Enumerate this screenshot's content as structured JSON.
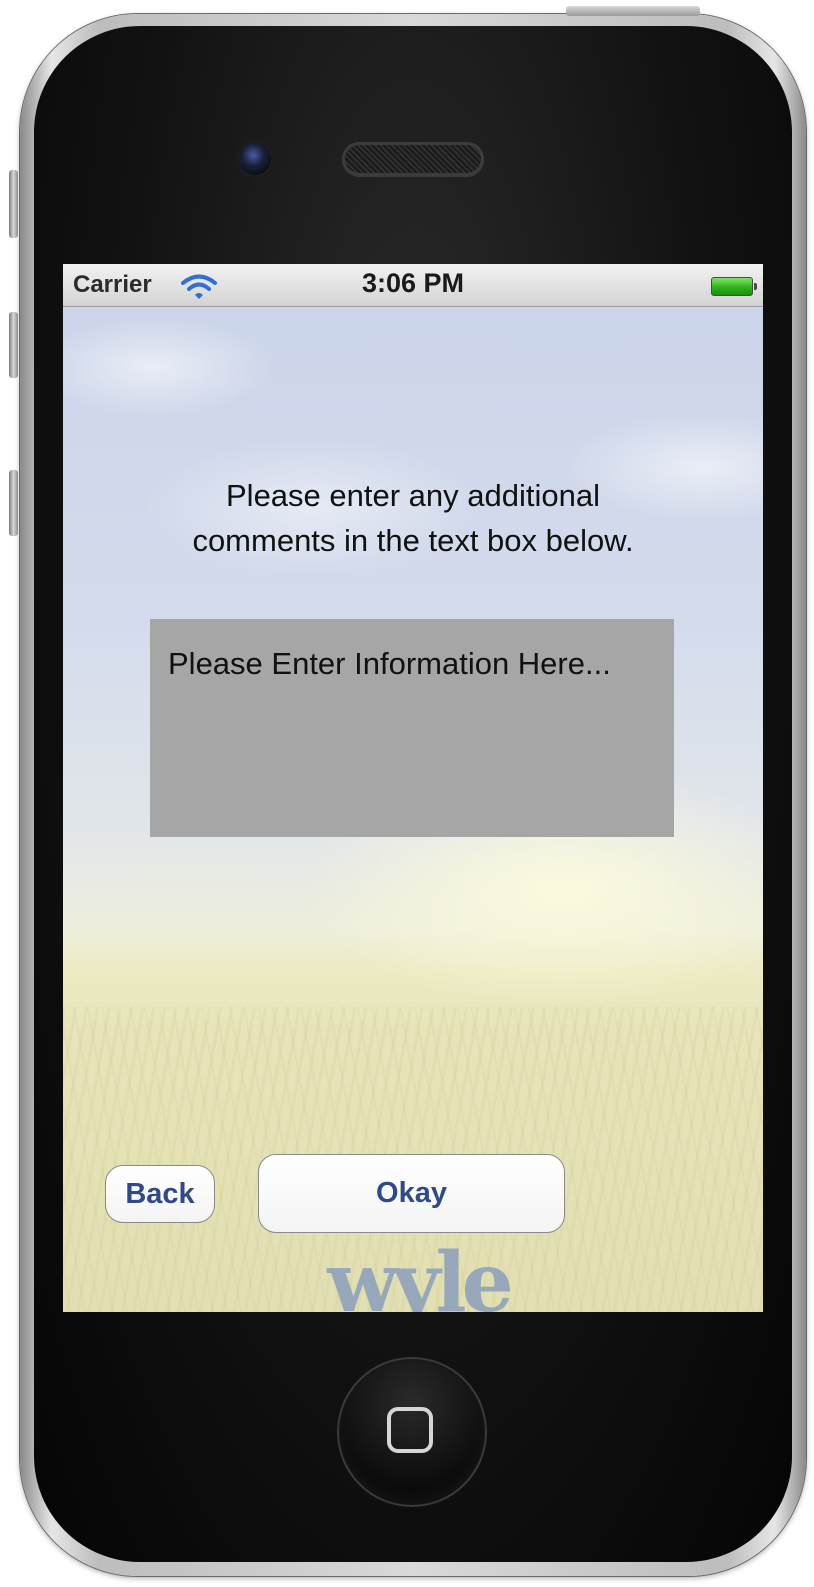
{
  "status_bar": {
    "carrier": "Carrier",
    "time": "3:06 PM",
    "wifi_icon": "wifi-icon",
    "battery_icon": "battery-full-icon"
  },
  "screen": {
    "prompt_line1": "Please enter any additional",
    "prompt_line2": "comments in the text box below.",
    "textbox_placeholder": "Please Enter Information Here...",
    "back_label": "Back",
    "okay_label": "Okay",
    "logo_text": "wyle"
  },
  "device": {
    "home_button_icon": "rounded-square-icon"
  },
  "colors": {
    "button_text": "#2f4a86",
    "textbox_bg": "#a6a6a6",
    "logo": "#8b9fbd"
  }
}
